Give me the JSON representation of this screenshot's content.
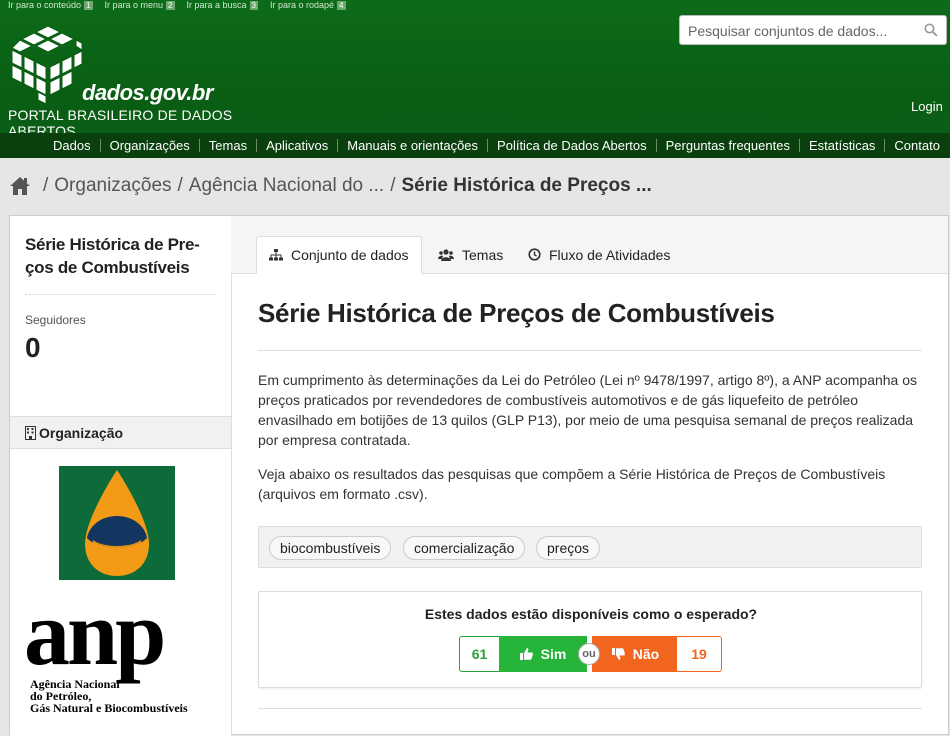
{
  "skip_links": [
    {
      "label": "Ir para o conteúdo",
      "num": "1"
    },
    {
      "label": "Ir para o menu",
      "num": "2"
    },
    {
      "label": "Ir para a busca",
      "num": "3"
    },
    {
      "label": "Ir para o rodapé",
      "num": "4"
    }
  ],
  "brand": {
    "name": "dados.gov.br",
    "subtitle": "PORTAL BRASILEIRO DE DADOS ABERTOS"
  },
  "search": {
    "placeholder": "Pesquisar conjuntos de dados..."
  },
  "login_label": "Login",
  "nav": [
    "Dados",
    "Organizações",
    "Temas",
    "Aplicativos",
    "Manuais e orientações",
    "Política de Dados Abertos",
    "Perguntas frequentes",
    "Estatísticas",
    "Contato"
  ],
  "breadcrumb": {
    "sep": "/",
    "items": [
      "Organizações",
      "Agência Nacional do ...",
      "Série Histórica de Preços ..."
    ]
  },
  "sidebar": {
    "title": "Série Histórica de Pre-ços de Combustíveis",
    "followers_label": "Seguidores",
    "followers_count": "0",
    "org_header": "Organização",
    "org_logo_text": "anp",
    "org_logo_sub": [
      "Agência Nacional",
      "do Petróleo,",
      "Gás Natural e Biocombustíveis"
    ]
  },
  "tabs": [
    "Conjunto de dados",
    "Temas",
    "Fluxo de Atividades"
  ],
  "main": {
    "title": "Série Histórica de Preços de Combustíveis",
    "description_1": "Em cumprimento às determinações da Lei do Petróleo (Lei nº 9478/1997, artigo 8º), a ANP acompanha os preços praticados por revendedores de combustíveis automotivos e de gás liquefeito de petróleo envasilhado em botijões de 13 quilos (GLP P13), por meio de uma pesquisa semanal de preços realizada por empresa contratada.",
    "description_2": "Veja abaixo os resultados das pesquisas que compõem a Série Histórica de Preços de Combustíveis (arquivos em formato .csv).",
    "tags": [
      "biocombustíveis",
      "comercialização",
      "preços"
    ]
  },
  "feedback": {
    "question": "Estes dados estão disponíveis como o esperado?",
    "yes_count": "61",
    "yes_label": "Sim",
    "or_label": "ou",
    "no_label": "Não",
    "no_count": "19"
  },
  "colors": {
    "header_green": "#0a5e14",
    "nav_dark": "#0a3f0e",
    "yes_green": "#27b43a",
    "no_orange": "#f2651f"
  }
}
